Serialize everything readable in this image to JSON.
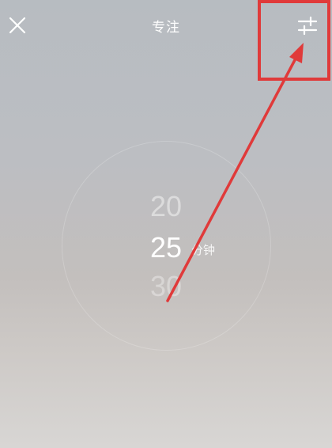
{
  "header": {
    "title": "专注",
    "close_icon": "close-icon",
    "settings_icon": "adjust-settings-icon"
  },
  "picker": {
    "prev_value": "20",
    "current_value": "25",
    "next_value": "30",
    "unit": "分钟"
  },
  "annotation": {
    "color": "#e03a3a"
  }
}
